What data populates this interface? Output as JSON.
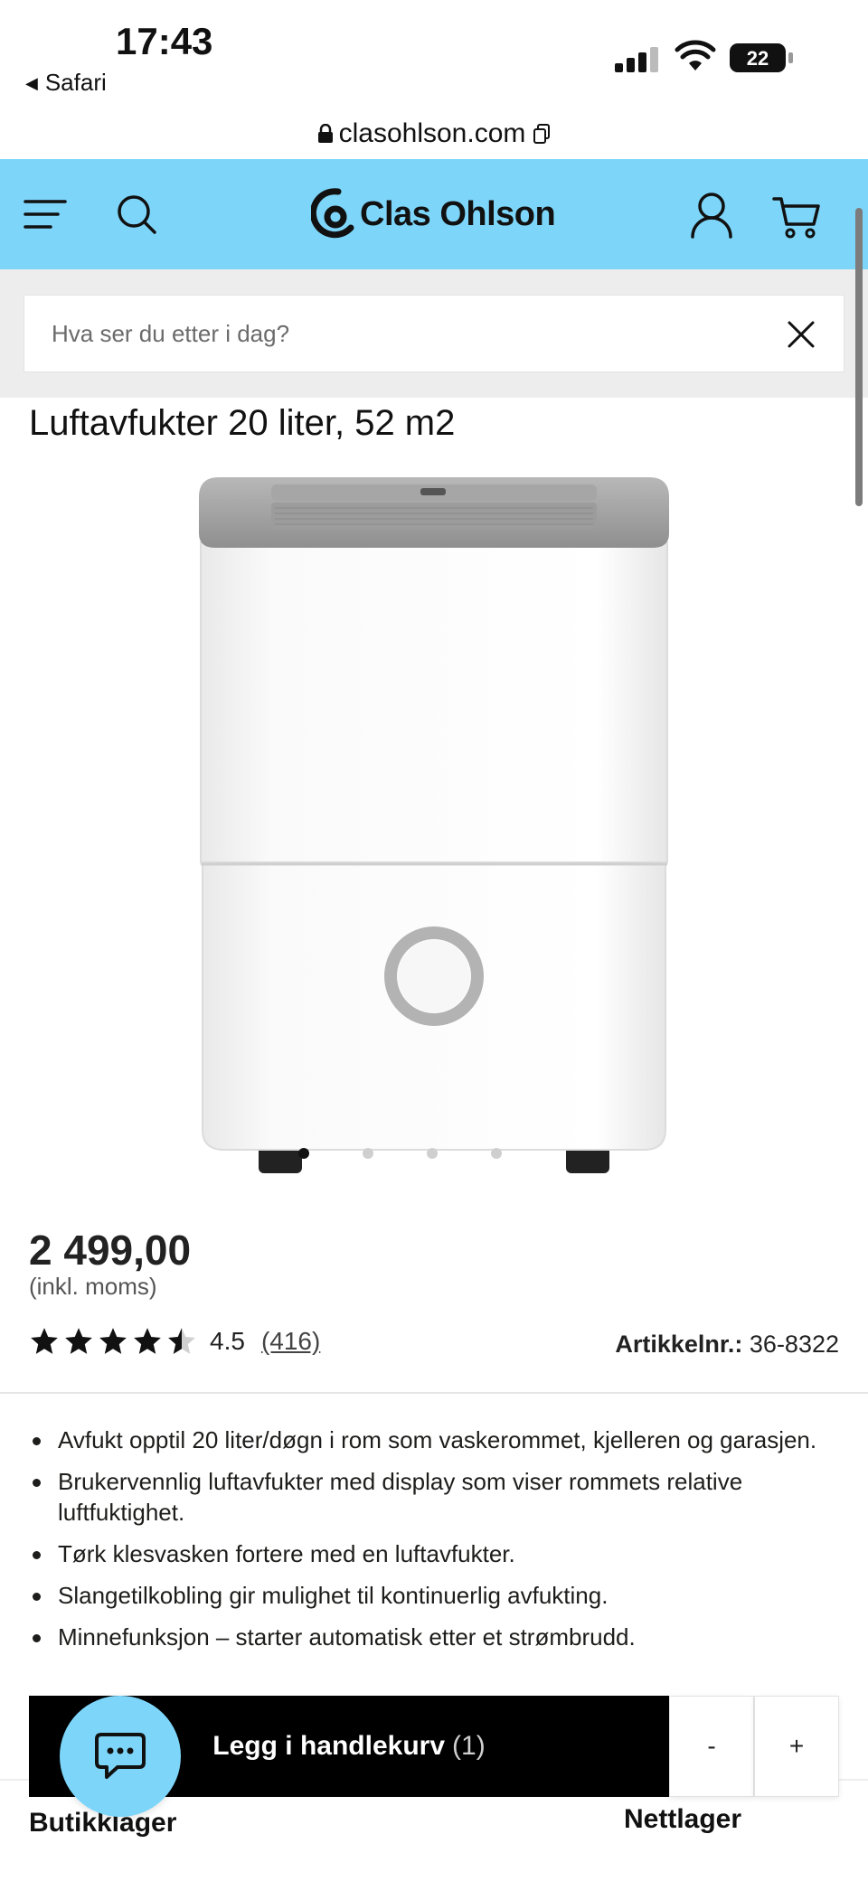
{
  "status_bar": {
    "time": "17:43",
    "back_label": "Safari",
    "battery": "22"
  },
  "browser": {
    "url": "clasohlson.com"
  },
  "header": {
    "brand": "Clas Ohlson",
    "brand_color": "#7dd6fa",
    "icons": [
      "menu-icon",
      "search-icon",
      "account-icon",
      "cart-icon"
    ]
  },
  "search": {
    "placeholder": "Hva ser du etter i dag?"
  },
  "product": {
    "title": "Luftavfukter 20 liter, 52 m2",
    "image_count": 5,
    "active_image": 1,
    "price": "2 499,00",
    "vat_note": "(inkl. moms)",
    "rating": 4.5,
    "rating_label": "4.5",
    "review_count": "(416)",
    "article_label": "Artikkelnr.:",
    "article_number": "36-8322",
    "features": [
      "Avfukt opptil 20 liter/døgn i rom som vaskerommet, kjelleren og garasjen.",
      "Brukervennlig luftavfukter med display som viser rommets relative luftfuktighet.",
      "Tørk klesvasken fortere med en luftavfukter.",
      "Slangetilkobling gir mulighet til kontinuerlig avfukting.",
      "Minnefunksjon – starter automatisk etter et strømbrudd."
    ]
  },
  "cart_bar": {
    "add_label": "Legg i handlekurv",
    "quantity": "(1)",
    "decrement_label": "-",
    "increment_label": "+"
  },
  "stock": {
    "store_label": "Butikklager",
    "online_label": "Nettlager"
  }
}
